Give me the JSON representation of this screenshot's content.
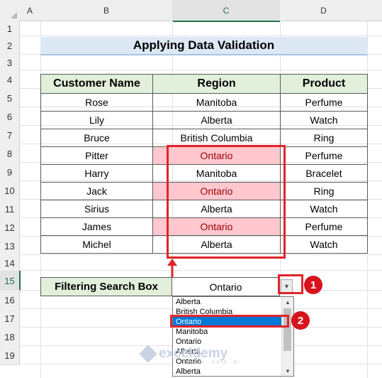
{
  "columns": [
    "A",
    "B",
    "C",
    "D"
  ],
  "rows": [
    "1",
    "2",
    "3",
    "4",
    "5",
    "6",
    "7",
    "8",
    "9",
    "10",
    "11",
    "12",
    "13",
    "14",
    "15",
    "16",
    "17",
    "18",
    "19"
  ],
  "title": "Applying Data Validation",
  "table": {
    "headers": [
      "Customer Name",
      "Region",
      "Product"
    ],
    "rows": [
      {
        "name": "Rose",
        "region": "Manitoba",
        "product": "Perfume"
      },
      {
        "name": "Lily",
        "region": "Alberta",
        "product": "Watch"
      },
      {
        "name": "Bruce",
        "region": "British Columbia",
        "product": "Ring"
      },
      {
        "name": "Pitter",
        "region": "Ontario",
        "product": "Perfume"
      },
      {
        "name": "Harry",
        "region": "Manitoba",
        "product": "Bracelet"
      },
      {
        "name": "Jack",
        "region": "Ontario",
        "product": "Ring"
      },
      {
        "name": "Sirius",
        "region": "Alberta",
        "product": "Watch"
      },
      {
        "name": "James",
        "region": "Ontario",
        "product": "Perfume"
      },
      {
        "name": "Michel",
        "region": "Alberta",
        "product": "Watch"
      }
    ]
  },
  "filter": {
    "label": "Filtering Search Box",
    "value": "Ontario"
  },
  "dropdown": {
    "options": [
      "Alberta",
      "British Columbia",
      "Ontario",
      "Manitoba",
      "Ontario",
      "Alberta",
      "Ontario",
      "Alberta"
    ],
    "selected_index": 2
  },
  "badges": [
    "1",
    "2"
  ],
  "watermark": {
    "name": "exceldemy",
    "tagline": "EXCEL · DATA · BI"
  },
  "colors": {
    "highlight_fill": "#ffc7ce",
    "highlight_text": "#9c0006",
    "header_fill": "#e2efda",
    "title_fill": "#dde8f5",
    "annotation_red": "#e0242b",
    "selection_blue": "#0078d7"
  }
}
